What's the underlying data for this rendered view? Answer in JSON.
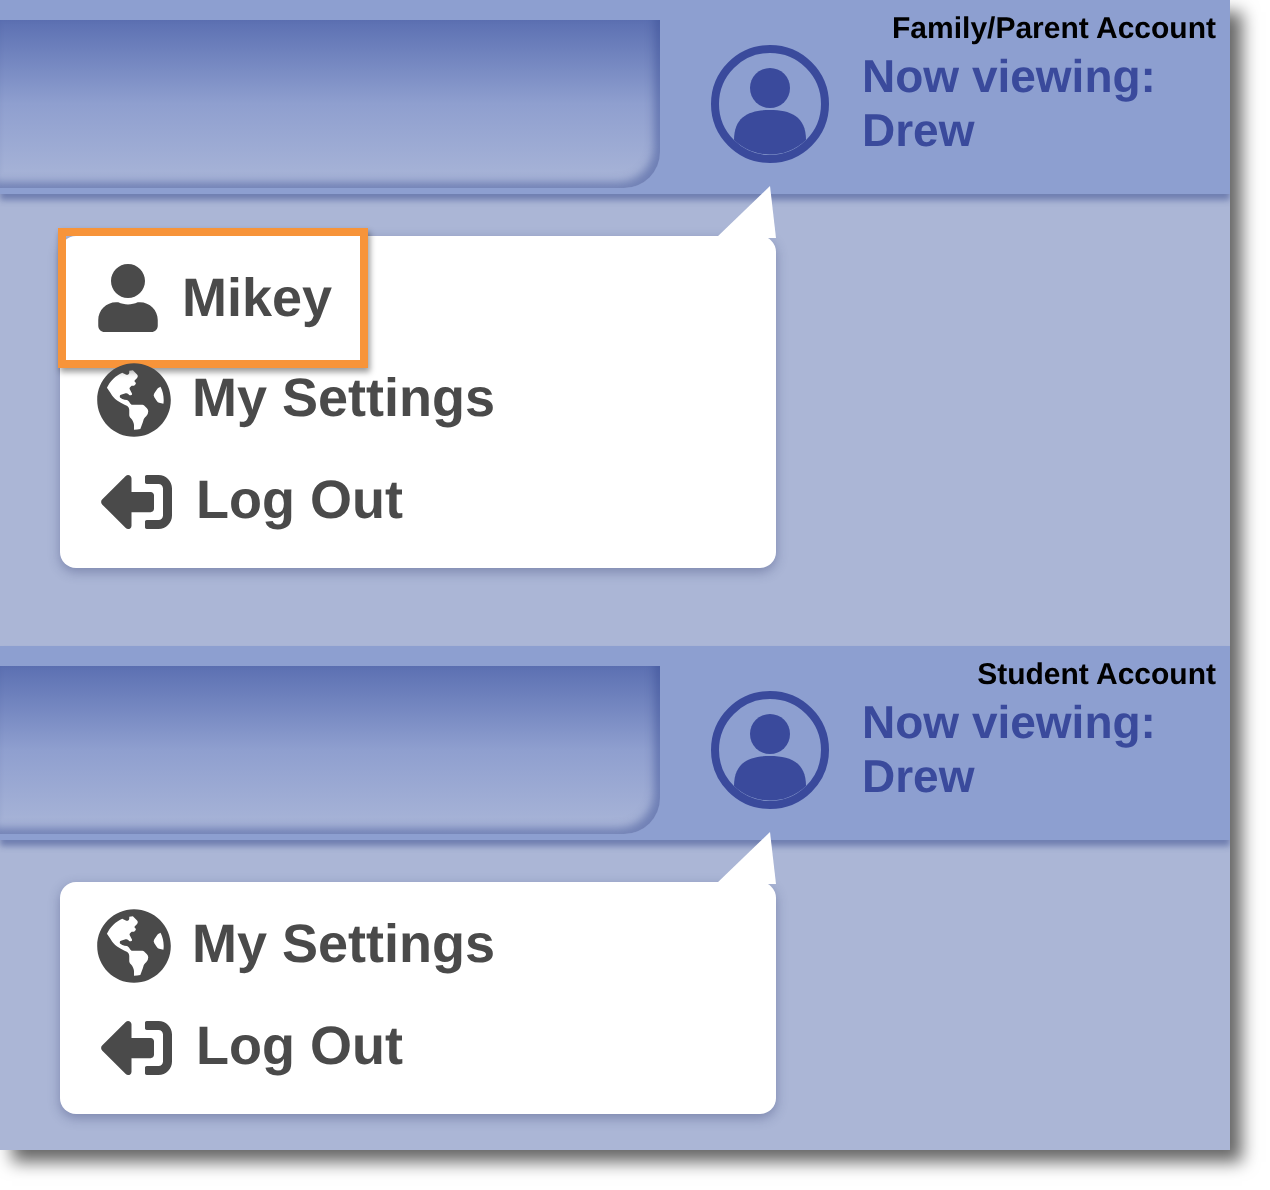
{
  "panels": [
    {
      "caption": "Family/Parent Account",
      "viewing_label": "Now viewing:",
      "viewing_name": "Drew",
      "menu": [
        {
          "kind": "user",
          "label": "Mikey",
          "highlighted": true
        },
        {
          "kind": "settings",
          "label": "My Settings",
          "highlighted": false
        },
        {
          "kind": "logout",
          "label": "Log Out",
          "highlighted": false
        }
      ]
    },
    {
      "caption": "Student Account",
      "viewing_label": "Now viewing:",
      "viewing_name": "Drew",
      "menu": [
        {
          "kind": "settings",
          "label": "My Settings",
          "highlighted": false
        },
        {
          "kind": "logout",
          "label": "Log Out",
          "highlighted": false
        }
      ]
    }
  ]
}
